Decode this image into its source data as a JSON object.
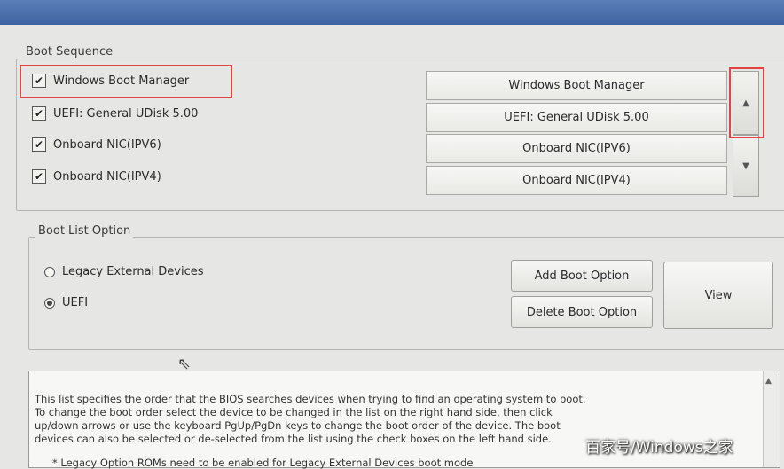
{
  "boot_sequence": {
    "title": "Boot Sequence",
    "checkbox_items": [
      {
        "label": "Windows Boot Manager",
        "checked": true
      },
      {
        "label": "UEFI: General UDisk 5.00",
        "checked": true
      },
      {
        "label": "Onboard NIC(IPV6)",
        "checked": true
      },
      {
        "label": "Onboard NIC(IPV4)",
        "checked": true
      }
    ],
    "order_list": [
      "Windows Boot Manager",
      "UEFI: General UDisk 5.00",
      "Onboard NIC(IPV6)",
      "Onboard NIC(IPV4)"
    ],
    "up_arrow": "▲",
    "down_arrow": "▼"
  },
  "boot_list_option": {
    "title": "Boot List Option",
    "options": [
      {
        "label": "Legacy External Devices",
        "selected": false
      },
      {
        "label": "UEFI",
        "selected": true
      }
    ],
    "add_button": "Add Boot Option",
    "delete_button": "Delete Boot Option",
    "view_button": "View"
  },
  "help": {
    "text": "This list specifies the order that the BIOS searches devices when trying to find an operating system to boot.\nTo change the boot order select the device to be changed in the list on the right hand side, then click\nup/down arrows or use the keyboard PgUp/PgDn keys to change the boot order of the device. The boot\ndevices can also be selected or de-selected from the list using the check boxes on the left hand side.",
    "note": "* Legacy Option ROMs need to be enabled for Legacy External Devices boot mode"
  },
  "watermark": "百家号/Windows之家",
  "colors": {
    "highlight": "#e04444",
    "title_bar": "#3e62a0"
  }
}
